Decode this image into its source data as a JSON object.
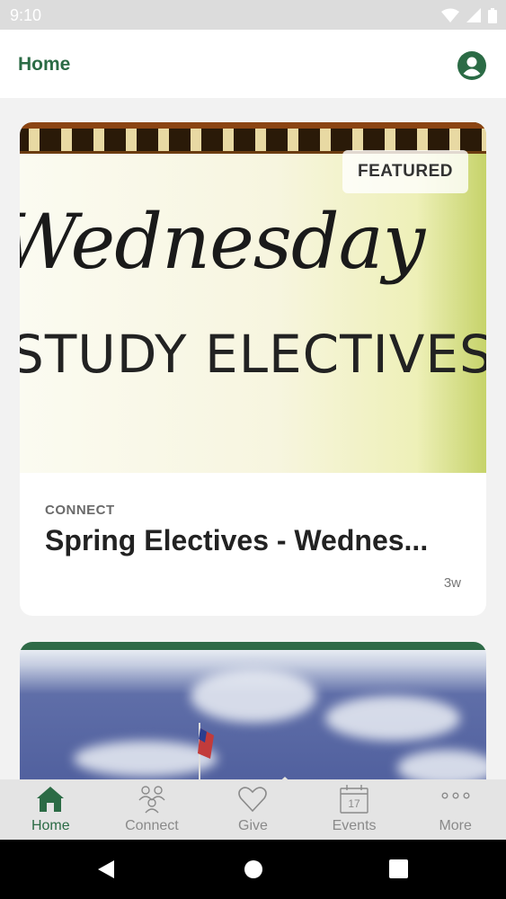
{
  "status_bar": {
    "time": "9:10"
  },
  "header": {
    "title": "Home"
  },
  "feed": {
    "featured_card": {
      "badge": "FEATURED",
      "image_title": "Wednesday",
      "image_subtitle": "STUDY ELECTIVES",
      "category": "CONNECT",
      "title": "Spring Electives - Wednes...",
      "age": "3w"
    }
  },
  "bottom_nav": {
    "items": [
      {
        "label": "Home",
        "icon": "home-icon",
        "active": true
      },
      {
        "label": "Connect",
        "icon": "people-icon",
        "active": false
      },
      {
        "label": "Give",
        "icon": "heart-icon",
        "active": false
      },
      {
        "label": "Events",
        "icon": "calendar-icon",
        "active": false,
        "icon_text": "17"
      },
      {
        "label": "More",
        "icon": "more-dots-icon",
        "active": false
      }
    ]
  },
  "colors": {
    "accent": "#2b6b45",
    "inactive": "#8a8a8a"
  }
}
